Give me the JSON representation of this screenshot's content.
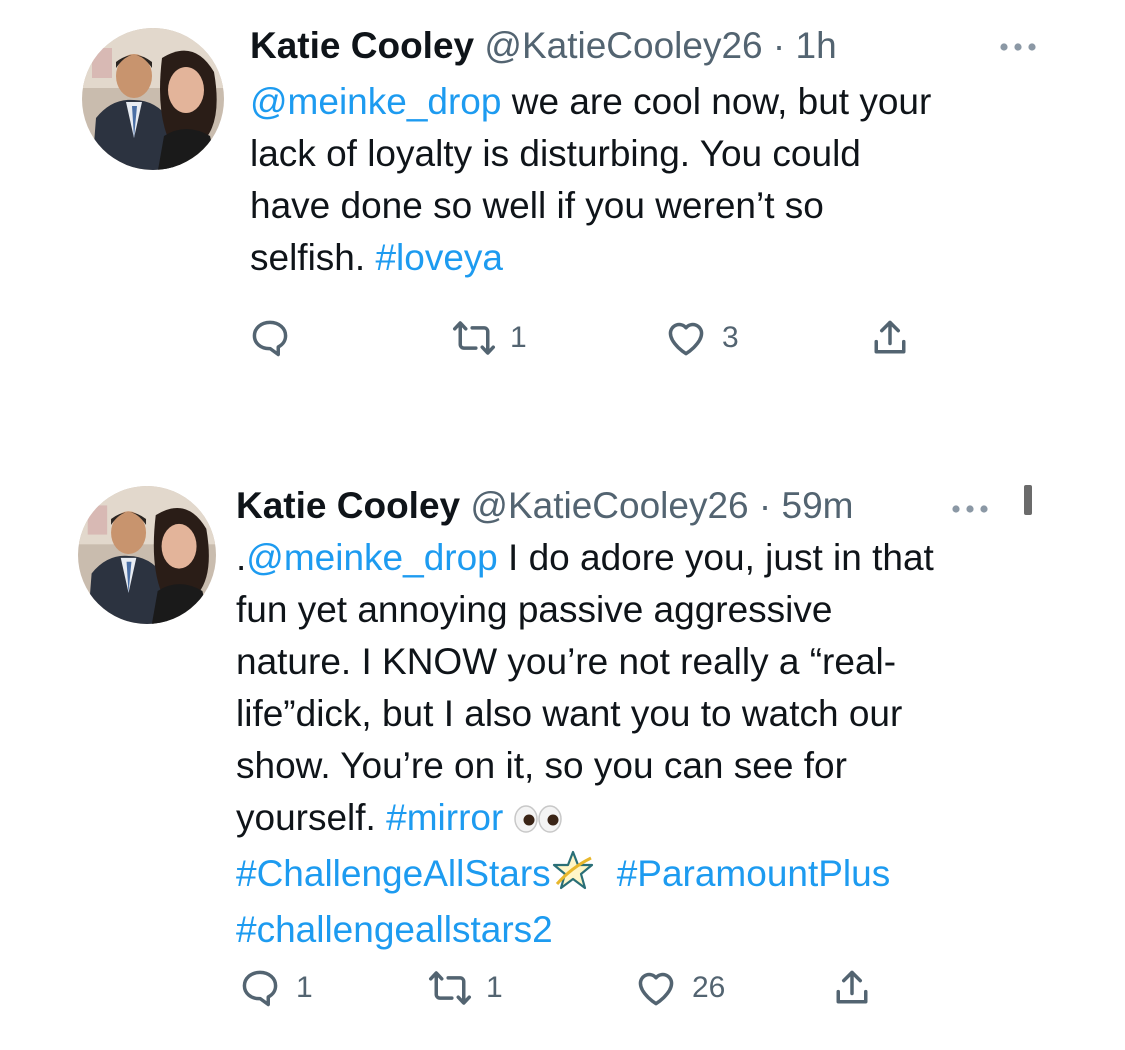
{
  "tweets": [
    {
      "name": "Katie Cooley",
      "handle": "@KatieCooley26",
      "dot": "·",
      "time": "1h",
      "text": {
        "mention": "@meinke_drop",
        "line1_rest": " we are cool now, but your",
        "line2": "lack of loyalty is disturbing. You could",
        "line3": "have done so well if you weren’t so",
        "line4_plain": "selfish. ",
        "hashtag": "#loveya"
      },
      "actions": {
        "reply": "",
        "retweet": "1",
        "like": "3"
      }
    },
    {
      "name": "Katie Cooley",
      "handle": "@KatieCooley26",
      "dot": "·",
      "time": "59m",
      "text": {
        "prefix": ".",
        "mention": "@meinke_drop",
        "line1_rest": " I do adore you, just in that",
        "line2": "fun yet annoying passive aggressive",
        "line3": "nature. I KNOW you’re not really a “real-",
        "line4": "life”dick, but I also want you to watch our",
        "line5": "show. You’re on it, so you can see for",
        "line6_plain": "yourself. ",
        "hashtag_mirror": "#mirror",
        "hashtag_allstars": "#ChallengeAllStars",
        "hashtag_paramount": "#ParamountPlus",
        "hashtag_allstars2": "#challengeallstars2"
      },
      "actions": {
        "reply": "1",
        "retweet": "1",
        "like": "26"
      }
    }
  ],
  "icons": {
    "reply": "reply-icon",
    "retweet": "retweet-icon",
    "like": "heart-icon",
    "share": "share-icon",
    "more": "more-options-icon",
    "eyes": "eyes-emoji",
    "star": "star-emoji"
  },
  "colors": {
    "link": "#1d9bf0",
    "secondary": "#536471",
    "text": "#0f1419"
  }
}
